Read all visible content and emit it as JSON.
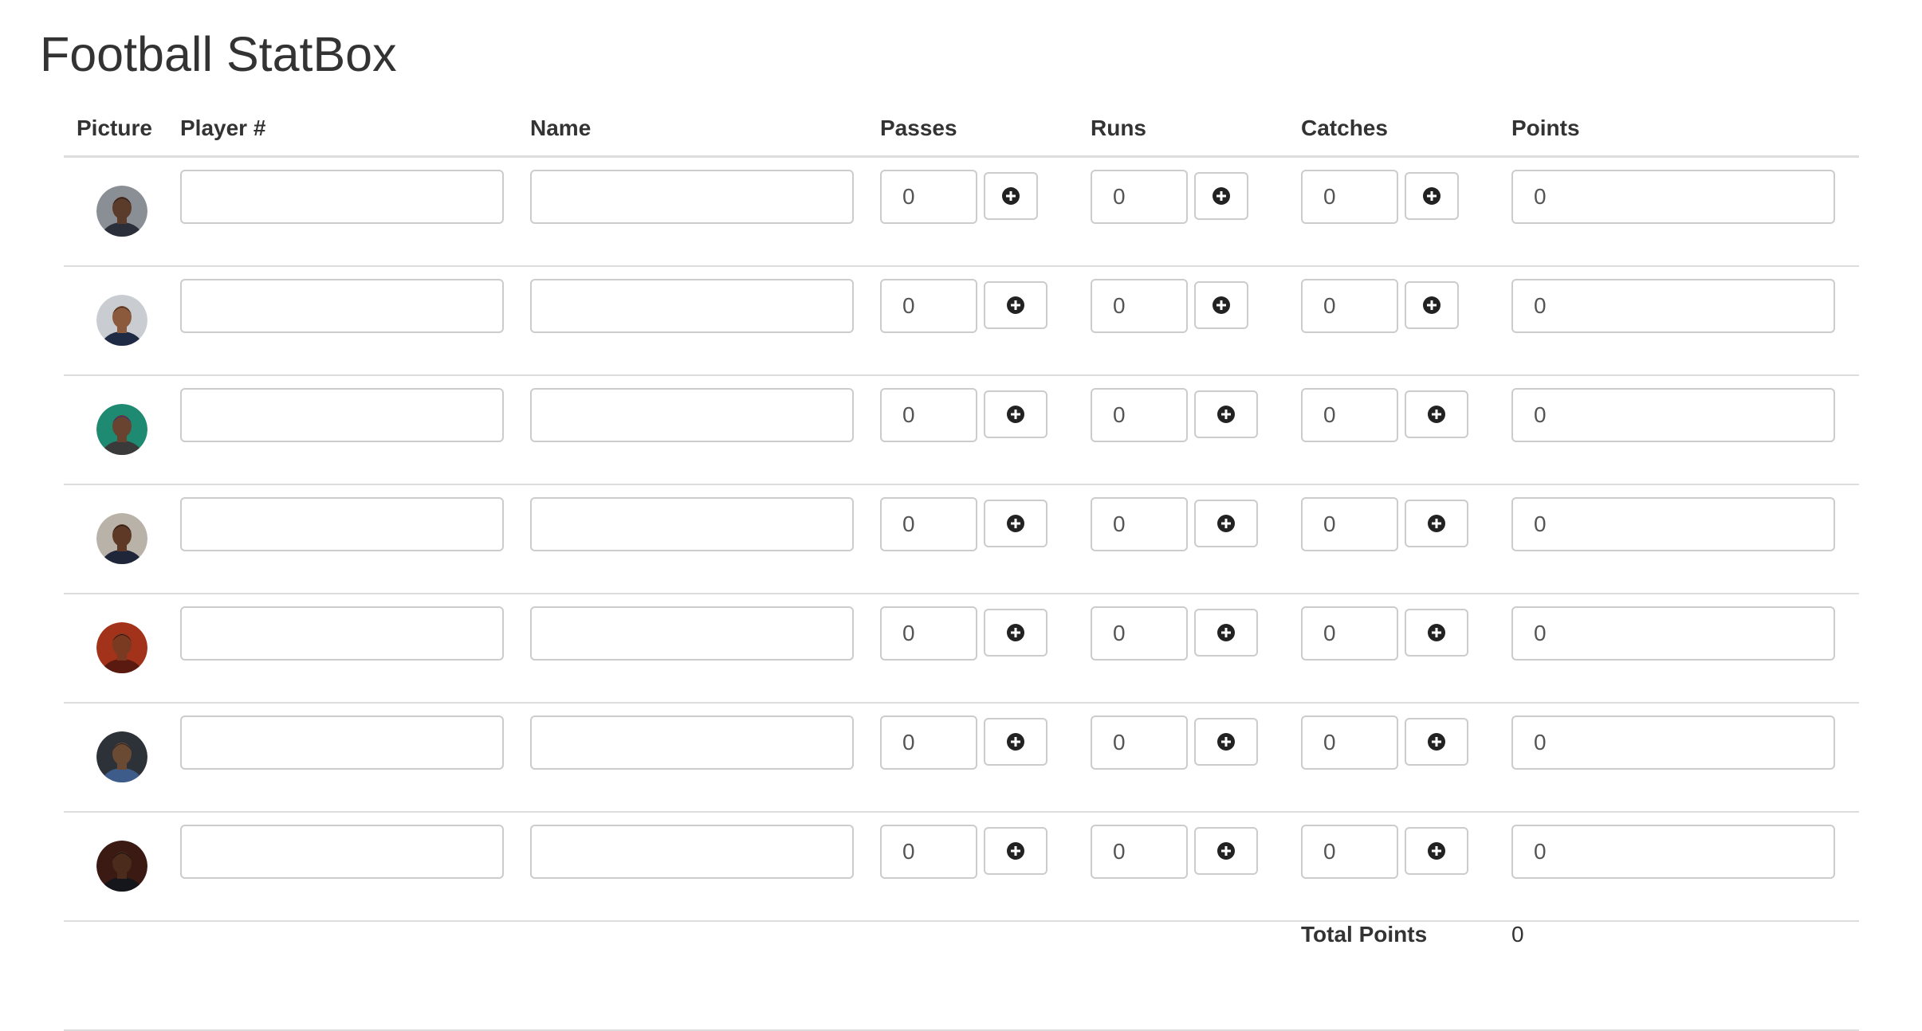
{
  "page_title": "Football StatBox",
  "columns": {
    "picture": "Picture",
    "player_num": "Player #",
    "name": "Name",
    "passes": "Passes",
    "runs": "Runs",
    "catches": "Catches",
    "points": "Points"
  },
  "rows": [
    {
      "player_num": "",
      "name": "",
      "passes": "0",
      "runs": "0",
      "catches": "0",
      "points": "0"
    },
    {
      "player_num": "",
      "name": "",
      "passes": "0",
      "runs": "0",
      "catches": "0",
      "points": "0"
    },
    {
      "player_num": "",
      "name": "",
      "passes": "0",
      "runs": "0",
      "catches": "0",
      "points": "0"
    },
    {
      "player_num": "",
      "name": "",
      "passes": "0",
      "runs": "0",
      "catches": "0",
      "points": "0"
    },
    {
      "player_num": "",
      "name": "",
      "passes": "0",
      "runs": "0",
      "catches": "0",
      "points": "0"
    },
    {
      "player_num": "",
      "name": "",
      "passes": "0",
      "runs": "0",
      "catches": "0",
      "points": "0"
    },
    {
      "player_num": "",
      "name": "",
      "passes": "0",
      "runs": "0",
      "catches": "0",
      "points": "0"
    }
  ],
  "total": {
    "label": "Total Points",
    "value": "0"
  },
  "icons": {
    "add": "plus-circle-icon",
    "avatar": "player-avatar"
  },
  "colors": {
    "text": "#333333",
    "border": "#cccccc",
    "divider": "#dddddd",
    "icon": "#222222"
  }
}
